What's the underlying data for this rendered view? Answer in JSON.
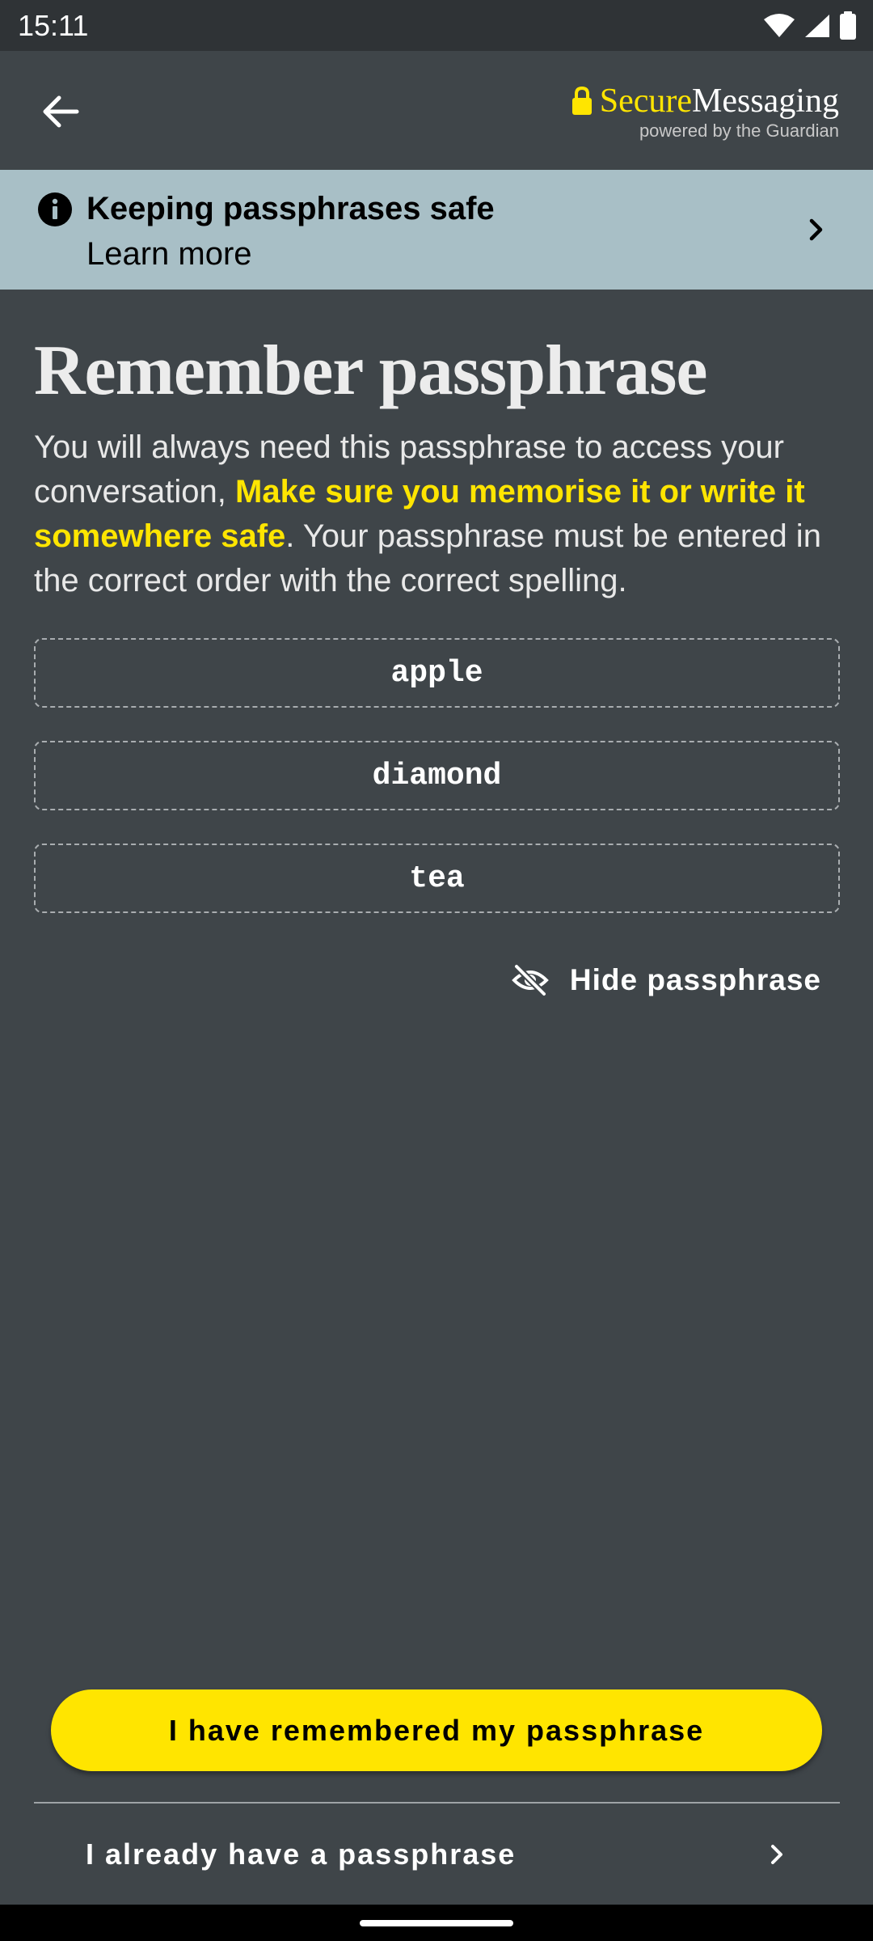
{
  "status_bar": {
    "time": "15:11",
    "icons": [
      "wifi-icon",
      "cell-signal-icon",
      "battery-icon"
    ]
  },
  "app_bar": {
    "back_icon": "arrow-left-icon",
    "logo": {
      "secure": "Secure",
      "messaging": "Messaging",
      "subtitle": "powered by the Guardian",
      "icon": "lock-icon"
    }
  },
  "banner": {
    "icon": "info-icon",
    "title": "Keeping passphrases safe",
    "link": "Learn more",
    "chevron": "chevron-right-icon"
  },
  "main": {
    "title": "Remember passphrase",
    "intro_part1": "You will always need this passphrase to access your conversation, ",
    "intro_highlight": "Make sure you memorise it or write it somewhere safe",
    "intro_part2": ". Your passphrase must be entered in the correct order with the correct spelling.",
    "words": [
      "apple",
      "diamond",
      "tea"
    ],
    "hide_toggle": {
      "label": "Hide passphrase",
      "icon": "eye-off-icon"
    }
  },
  "footer": {
    "primary_button": "I have remembered my passphrase",
    "secondary_link": "I already have a passphrase"
  },
  "colors": {
    "background": "#3f4549",
    "status_bar": "#2f3336",
    "banner": "#a8bfc6",
    "accent": "#ffe500"
  }
}
